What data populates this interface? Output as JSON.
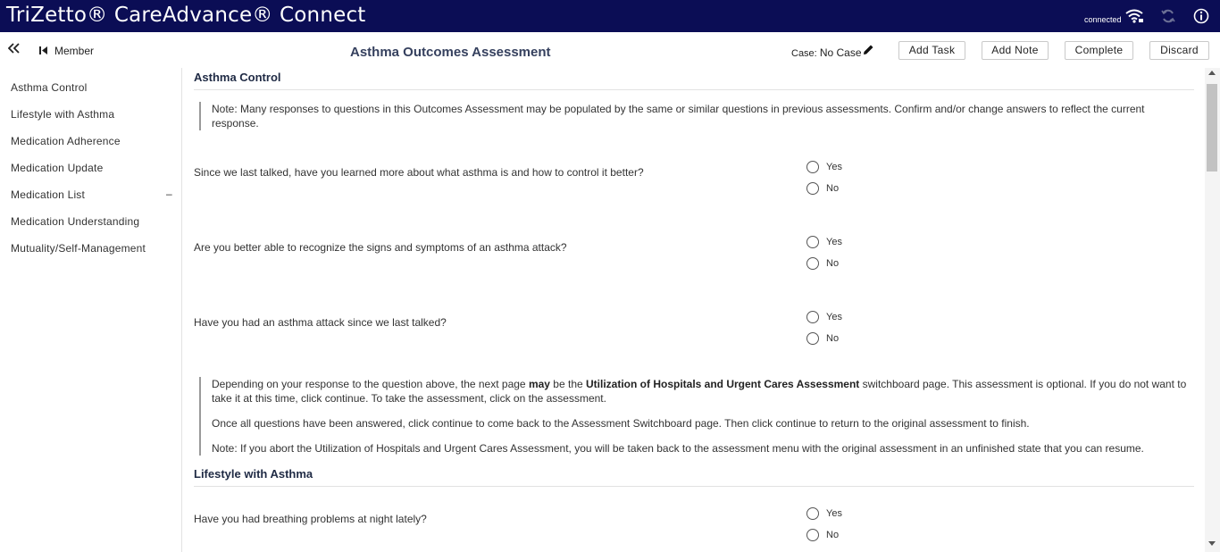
{
  "header": {
    "brand": "TriZetto® CareAdvance® Connect",
    "connection_status": "connected",
    "icons": [
      "wifi-icon",
      "sync-icon",
      "info-icon"
    ]
  },
  "subheader": {
    "member_label": "Member",
    "page_title": "Asthma Outcomes Assessment",
    "case_label": "Case:",
    "case_value": "No Case",
    "buttons": {
      "add_task": "Add Task",
      "add_note": "Add Note",
      "complete": "Complete",
      "discard": "Discard"
    }
  },
  "sidebar": {
    "items": [
      {
        "label": "Asthma Control"
      },
      {
        "label": "Lifestyle with Asthma"
      },
      {
        "label": "Medication Adherence"
      },
      {
        "label": "Medication Update"
      },
      {
        "label": "Medication List",
        "suffix": "–"
      },
      {
        "label": "Medication Understanding"
      },
      {
        "label": "Mutuality/Self-Management"
      }
    ]
  },
  "content": {
    "section1_title": "Asthma Control",
    "note1_line1": "Note: Many responses to questions in this Outcomes Assessment may be populated by the same or similar questions in previous assessments. Confirm and/or change answers to reflect the current",
    "note1_line2": "response.",
    "questions": [
      {
        "text": "Since we last talked, have you learned more about what asthma is and how to control it better?",
        "options": [
          "Yes",
          "No"
        ]
      },
      {
        "text": "Are you better able to recognize the signs and symptoms of an asthma attack?",
        "options": [
          "Yes",
          "No"
        ]
      },
      {
        "text": "Have you had an asthma attack since we last talked?",
        "options": [
          "Yes",
          "No"
        ]
      },
      {
        "text": "Have you had breathing problems at night lately?",
        "options": [
          "Yes",
          "No"
        ]
      }
    ],
    "info_p1_a": "Depending on your response to the question above, the next page ",
    "info_p1_bold1": "may",
    "info_p1_b": " be the ",
    "info_p1_bold2": "Utilization of Hospitals and Urgent Cares Assessment",
    "info_p1_c": " switchboard page. This assessment is optional. If you do not want to",
    "info_p1_line2": "take it at this time, click continue. To take the assessment, click on the assessment.",
    "info_p2": "Once all questions have been answered, click continue to come back to the Assessment Switchboard page. Then click continue to return to the original assessment to finish.",
    "info_p3": "Note: If you abort the Utilization of Hospitals and Urgent Cares Assessment, you will be taken back to the assessment menu with the original assessment in an unfinished state that you can resume.",
    "section2_title": "Lifestyle with Asthma"
  }
}
